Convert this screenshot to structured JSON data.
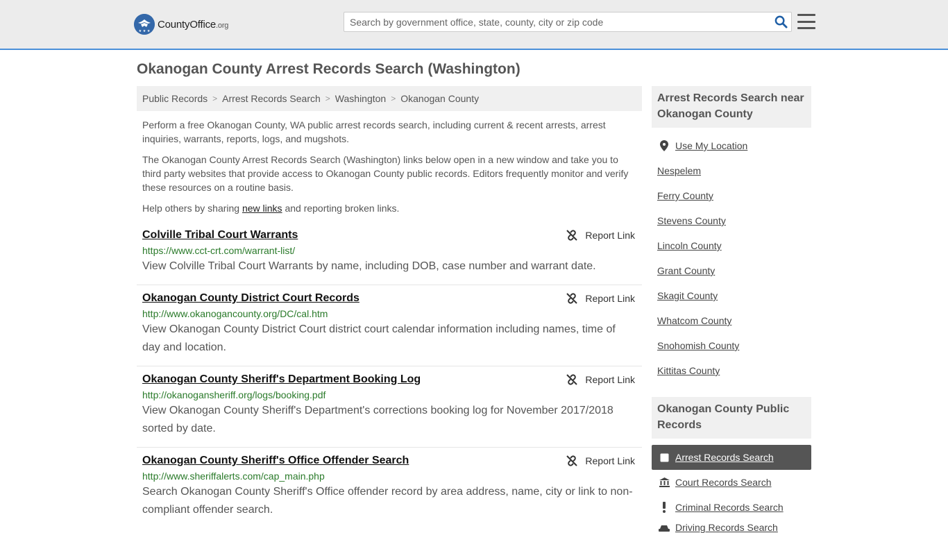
{
  "header": {
    "logo_main": "CountyOffice",
    "logo_suffix": ".org",
    "search_placeholder": "Search by government office, state, county, city or zip code"
  },
  "page_title": "Okanogan County Arrest Records Search (Washington)",
  "breadcrumb": [
    "Public Records",
    "Arrest Records Search",
    "Washington",
    "Okanogan County"
  ],
  "intro": {
    "p1": "Perform a free Okanogan County, WA public arrest records search, including current & recent arrests, arrest inquiries, warrants, reports, logs, and mugshots.",
    "p2": "The Okanogan County Arrest Records Search (Washington) links below open in a new window and take you to third party websites that provide access to Okanogan County public records. Editors frequently monitor and verify these resources on a routine basis.",
    "p3_before": "Help others by sharing ",
    "p3_link": "new links",
    "p3_after": " and reporting broken links."
  },
  "report_label": "Report Link",
  "results": [
    {
      "title": "Colville Tribal Court Warrants",
      "url": "https://www.cct-crt.com/warrant-list/",
      "desc": "View Colville Tribal Court Warrants by name, including DOB, case number and warrant date."
    },
    {
      "title": "Okanogan County District Court Records",
      "url": "http://www.okanogancounty.org/DC/cal.htm",
      "desc": "View Okanogan County District Court district court calendar information including names, time of day and location."
    },
    {
      "title": "Okanogan County Sheriff's Department Booking Log",
      "url": "http://okanogansheriff.org/logs/booking.pdf",
      "desc": "View Okanogan County Sheriff's Department's corrections booking log for November 2017/2018 sorted by date."
    },
    {
      "title": "Okanogan County Sheriff's Office Offender Search",
      "url": "http://www.sheriffalerts.com/cap_main.php",
      "desc": "Search Okanogan County Sheriff's Office offender record by area address, name, city or link to non-compliant offender search."
    }
  ],
  "sidebar": {
    "nearby_title": "Arrest Records Search near Okanogan County",
    "use_location": "Use My Location",
    "nearby": [
      "Nespelem",
      "Ferry County",
      "Stevens County",
      "Lincoln County",
      "Grant County",
      "Skagit County",
      "Whatcom County",
      "Snohomish County",
      "Kittitas County"
    ],
    "public_title": "Okanogan County Public Records",
    "public_links": [
      "Arrest Records Search",
      "Court Records Search",
      "Criminal Records Search",
      "Driving Records Search"
    ]
  },
  "colors": {
    "accent": "#3468a9",
    "url_green": "#2a7a2a",
    "active_bg": "#555555"
  }
}
